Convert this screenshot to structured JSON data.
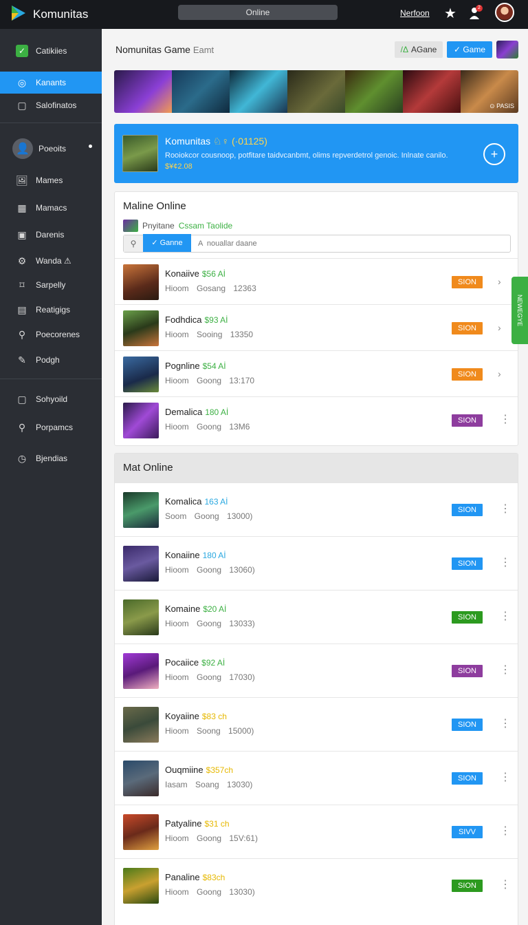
{
  "topbar": {
    "app_title": "Komunitas",
    "center_pill": "Online",
    "link": "Nerfoon",
    "notif_count": "2"
  },
  "sidebar": {
    "items": [
      {
        "label": "Catikiies",
        "icon": "check-icon"
      },
      {
        "label": "Kanants",
        "icon": "circle-icon",
        "active": true
      },
      {
        "label": "Salofinatos",
        "icon": "square-icon"
      },
      {
        "label": "Poeoits",
        "icon": "user-icon"
      },
      {
        "label": "Mames",
        "icon": "picture-icon"
      },
      {
        "label": "Mamacs",
        "icon": "grid-icon"
      },
      {
        "label": "Darenis",
        "icon": "box-icon"
      },
      {
        "label": "Wanda ⚠",
        "icon": "gear-icon"
      },
      {
        "label": "Sarpelly",
        "icon": "tag-icon"
      },
      {
        "label": "Reatigigs",
        "icon": "doc-icon"
      },
      {
        "label": "Poecorenes",
        "icon": "wrench-icon"
      },
      {
        "label": "Podgh",
        "icon": "edit-icon"
      },
      {
        "label": "Sohyoild",
        "icon": "square-icon"
      },
      {
        "label": "Porpamcs",
        "icon": "search-icon"
      },
      {
        "label": "Bjendias",
        "icon": "clock-icon"
      }
    ]
  },
  "main": {
    "title": "Nomunitas Game",
    "title_suffix": "Eamt",
    "btn_again": "AGane",
    "btn_again_prefix": "/Δ",
    "btn_game": "Game",
    "banner_tag": "⊙ PASIS",
    "hero": {
      "title": "Komunitas",
      "title_extra": "♘♀ (·01125)",
      "desc": "Rooiokcor cousnoop, potfitare taidvcanbmt, olims repverdetrol genoic. Inlnate canilo.",
      "price": "$¥¢2.08"
    }
  },
  "online_section": {
    "title": "Maline Online",
    "subtitle": "Pnyitane",
    "subtitle_green": "Cssam Taolide",
    "search_tab": "Ganne",
    "search_placeholder": "A  nouallar daane",
    "rows": [
      {
        "name": "Konaiive",
        "price": "$56 Aİ",
        "price_color": "#3cb043",
        "meta": "Hioom Gosang 12363",
        "btn": "SION",
        "btn_color": "#f08a1c",
        "thumb": "linear-gradient(160deg,#c9743a,#5a2a1a 60%,#2a1a10)",
        "action": "›"
      },
      {
        "name": "Fodhdica",
        "price": "$93 Aİ",
        "price_color": "#3cb043",
        "meta": "Hioom Sooing 13350",
        "btn": "SION",
        "btn_color": "#f08a1c",
        "thumb": "linear-gradient(160deg,#6aa04a,#2a3a1a 50%,#c9743a)",
        "action": "›"
      },
      {
        "name": "Pognline",
        "price": "$54 Aİ",
        "price_color": "#3cb043",
        "meta": "Hioom Goong 13:170",
        "btn": "SION",
        "btn_color": "#f08a1c",
        "thumb": "linear-gradient(160deg,#3a6aa0,#1a2a4a 60%,#6a8a3a)",
        "action": "›"
      },
      {
        "name": "Demalica",
        "price": "180 Aİ",
        "price_color": "#3cb043",
        "meta": "Hioom Goong 13M6",
        "btn": "SION",
        "btn_color": "#8e3d9e",
        "thumb": "linear-gradient(135deg,#2a1a4a,#a04ad6 50%,#3a1a5a)",
        "action": "⋮"
      }
    ]
  },
  "mat_section": {
    "title": "Mat Online",
    "rows": [
      {
        "name": "Komalica",
        "price": "163 Aİ",
        "price_color": "#29a8e0",
        "meta": "Soom Goong 13000)",
        "btn": "SION",
        "btn_color": "#2196f3",
        "thumb": "linear-gradient(160deg,#1a3a2a,#4a9a6a 50%,#1a2a3a)",
        "action": "⋮"
      },
      {
        "name": "Konaiine",
        "price": "180 Aİ",
        "price_color": "#29a8e0",
        "meta": "Hioom Goong 13060)",
        "btn": "SION",
        "btn_color": "#2196f3",
        "thumb": "linear-gradient(160deg,#3a2a6a,#6a5aa0 50%,#1a1a3a)",
        "action": "⋮"
      },
      {
        "name": "Komaine",
        "price": "$20 Aİ",
        "price_color": "#3cb043",
        "meta": "Hioom Goong 13033)",
        "btn": "SION",
        "btn_color": "#2c9a1f",
        "thumb": "linear-gradient(160deg,#4a6a2a,#8a9a4a 50%,#2a3a1a)",
        "action": "⋮"
      },
      {
        "name": "Pocaiice",
        "price": "$92 Aİ",
        "price_color": "#3cb043",
        "meta": "Hioom Goong 17030)",
        "btn": "SION",
        "btn_color": "#8e3d9e",
        "thumb": "linear-gradient(160deg,#a03ad6,#5a1a7a 50%,#f0b0c0)",
        "action": "⋮"
      },
      {
        "name": "Koyaiine",
        "price": "$83 ch",
        "price_color": "#e6b800",
        "meta": "Hioom Soong 15000)",
        "btn": "SION",
        "btn_color": "#2196f3",
        "thumb": "linear-gradient(160deg,#6a6a4a,#3a4a3a 50%,#8a7a5a)",
        "action": "⋮"
      },
      {
        "name": "Ouqmiine",
        "price": "$357ch",
        "price_color": "#e6b800",
        "meta": "Iasam Soang 13030)",
        "btn": "SION",
        "btn_color": "#2196f3",
        "thumb": "linear-gradient(160deg,#2a4a6a,#5a6a7a 50%,#3a2a2a)",
        "action": "⋮"
      },
      {
        "name": "Patyaline",
        "price": "$31 ch",
        "price_color": "#e6b800",
        "meta": "Hioom Goong 15V:61)",
        "btn": "SIVV",
        "btn_color": "#2196f3",
        "thumb": "linear-gradient(160deg,#c94a2a,#6a2a1a 50%,#e0a040)",
        "action": "⋮"
      },
      {
        "name": "Panaline",
        "price": "$83ch",
        "price_color": "#e6b800",
        "meta": "Hioom Goong 13030)",
        "btn": "SION",
        "btn_color": "#2c9a1f",
        "thumb": "linear-gradient(160deg,#4a7a1a,#c9a030 50%,#2a4a10)",
        "action": "⋮"
      }
    ]
  },
  "side_tab": "NEWEGYE"
}
